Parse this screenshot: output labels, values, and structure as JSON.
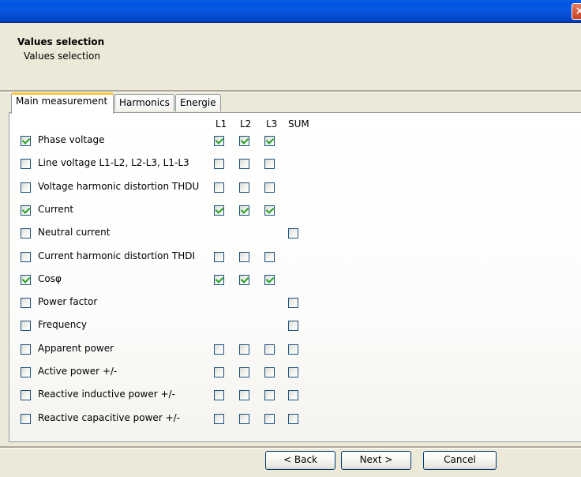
{
  "window": {
    "close_glyph": "×"
  },
  "header": {
    "title": "Values selection",
    "subtitle": "Values selection"
  },
  "tabs": [
    {
      "label": "Main measurement",
      "active": true
    },
    {
      "label": "Harmonics",
      "active": false
    },
    {
      "label": "Energie",
      "active": false
    }
  ],
  "columns": [
    "L1",
    "L2",
    "L3",
    "SUM"
  ],
  "rows": [
    {
      "label": "Phase voltage",
      "checked": true,
      "L1": true,
      "L2": true,
      "L3": true,
      "SUM": null
    },
    {
      "label": "Line voltage L1-L2, L2-L3, L1-L3",
      "checked": false,
      "L1": false,
      "L2": false,
      "L3": false,
      "SUM": null
    },
    {
      "label": "Voltage harmonic distortion THDU",
      "checked": false,
      "L1": false,
      "L2": false,
      "L3": false,
      "SUM": null
    },
    {
      "label": "Current",
      "checked": true,
      "L1": true,
      "L2": true,
      "L3": true,
      "SUM": null
    },
    {
      "label": "Neutral current",
      "checked": false,
      "L1": null,
      "L2": null,
      "L3": null,
      "SUM": false
    },
    {
      "label": "Current harmonic distortion THDI",
      "checked": false,
      "L1": false,
      "L2": false,
      "L3": false,
      "SUM": null
    },
    {
      "label": "Cosφ",
      "checked": true,
      "L1": true,
      "L2": true,
      "L3": true,
      "SUM": null
    },
    {
      "label": "Power factor",
      "checked": false,
      "L1": null,
      "L2": null,
      "L3": null,
      "SUM": false
    },
    {
      "label": "Frequency",
      "checked": false,
      "L1": null,
      "L2": null,
      "L3": null,
      "SUM": false
    },
    {
      "label": "Apparent power",
      "checked": false,
      "L1": false,
      "L2": false,
      "L3": false,
      "SUM": false
    },
    {
      "label": "Active power +/-",
      "checked": false,
      "L1": false,
      "L2": false,
      "L3": false,
      "SUM": false
    },
    {
      "label": "Reactive inductive power +/-",
      "checked": false,
      "L1": false,
      "L2": false,
      "L3": false,
      "SUM": false
    },
    {
      "label": "Reactive capacitive power +/-",
      "checked": false,
      "L1": false,
      "L2": false,
      "L3": false,
      "SUM": false
    }
  ],
  "buttons": {
    "back": "< Back",
    "next": "Next >",
    "cancel": "Cancel"
  }
}
